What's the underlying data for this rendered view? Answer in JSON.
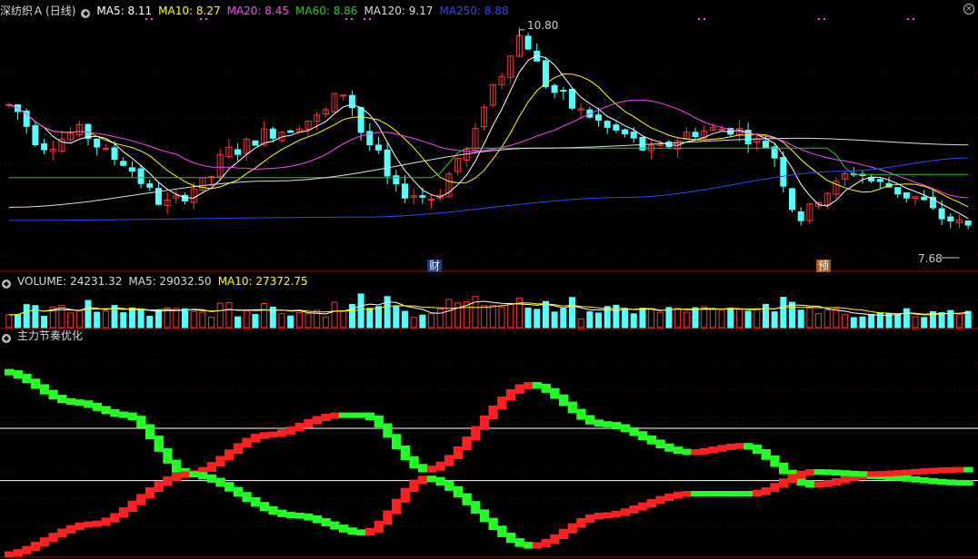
{
  "price_panel": {
    "stock_name": "深纺织Ａ",
    "period": "(日线)",
    "ma_items": [
      {
        "label": "MA5: 8.11",
        "color": "#ffffff"
      },
      {
        "label": "MA10: 8.27",
        "color": "#ffff00"
      },
      {
        "label": "MA20: 8.45",
        "color": "#ff44ff"
      },
      {
        "label": "MA60: 8.86",
        "color": "#22cc22"
      },
      {
        "label": "MA120: 9.17",
        "color": "#dddddd"
      },
      {
        "label": "MA250: 8.88",
        "color": "#2b48ff"
      }
    ],
    "high_label": "10.80",
    "low_label": "7.68",
    "event_tag_1": "财",
    "event_tag_2": "预"
  },
  "volume_panel": {
    "title": "VOLUME: 24231.32",
    "ma5": "MA5: 29032.50",
    "ma10": "MA10: 27372.75"
  },
  "indicator_panel": {
    "title": "主力节奏优化"
  },
  "colors": {
    "up": "#ff3333",
    "down": "#54ffff",
    "ind_up": "#ff2020",
    "ind_down": "#22ff22",
    "grid": "#6a0000"
  },
  "chart_data": {
    "type": "candlestick",
    "n_days": 110,
    "price_range": [
      7.3,
      11.0
    ],
    "price_keypoints": [
      [
        0,
        9.7
      ],
      [
        4,
        9.1
      ],
      [
        8,
        9.3
      ],
      [
        12,
        8.9
      ],
      [
        18,
        8.2
      ],
      [
        22,
        8.5
      ],
      [
        25,
        9.0
      ],
      [
        30,
        9.3
      ],
      [
        35,
        9.5
      ],
      [
        38,
        9.9
      ],
      [
        41,
        9.1
      ],
      [
        44,
        8.4
      ],
      [
        48,
        8.3
      ],
      [
        52,
        9.0
      ],
      [
        55,
        10.0
      ],
      [
        58,
        10.75
      ],
      [
        62,
        9.9
      ],
      [
        65,
        9.6
      ],
      [
        69,
        9.3
      ],
      [
        73,
        9.0
      ],
      [
        78,
        9.3
      ],
      [
        82,
        9.35
      ],
      [
        86,
        9.1
      ],
      [
        90,
        8.0
      ],
      [
        93,
        8.4
      ],
      [
        96,
        8.7
      ],
      [
        99,
        8.5
      ],
      [
        103,
        8.3
      ],
      [
        106,
        8.0
      ],
      [
        109,
        7.85
      ]
    ],
    "volume_range": [
      0,
      60000
    ],
    "ma_periods": [
      5,
      10,
      20,
      60,
      120,
      250
    ],
    "indicator": {
      "name": "主力节奏优化",
      "upper_keypoints": [
        [
          0,
          3.6
        ],
        [
          8,
          2.2
        ],
        [
          14,
          1.6
        ],
        [
          21,
          -1.1
        ],
        [
          30,
          0.7
        ],
        [
          38,
          1.6
        ],
        [
          41,
          1.6
        ],
        [
          48,
          -0.9
        ],
        [
          60,
          3.0
        ],
        [
          68,
          1.2
        ],
        [
          78,
          -0.1
        ],
        [
          84,
          0.2
        ],
        [
          92,
          -1.6
        ],
        [
          98,
          -1.2
        ],
        [
          109,
          -1.5
        ]
      ],
      "lower_keypoints": [
        [
          0,
          -4.8
        ],
        [
          10,
          -3.4
        ],
        [
          21,
          -1.1
        ],
        [
          33,
          -3.0
        ],
        [
          41,
          -3.8
        ],
        [
          48,
          -1.3
        ],
        [
          60,
          -4.4
        ],
        [
          68,
          -3.0
        ],
        [
          78,
          -2.0
        ],
        [
          85,
          -2.0
        ],
        [
          92,
          -1.0
        ],
        [
          98,
          -1.1
        ],
        [
          109,
          -0.9
        ]
      ],
      "reference_lines": [
        1.0,
        -1.4
      ]
    }
  }
}
